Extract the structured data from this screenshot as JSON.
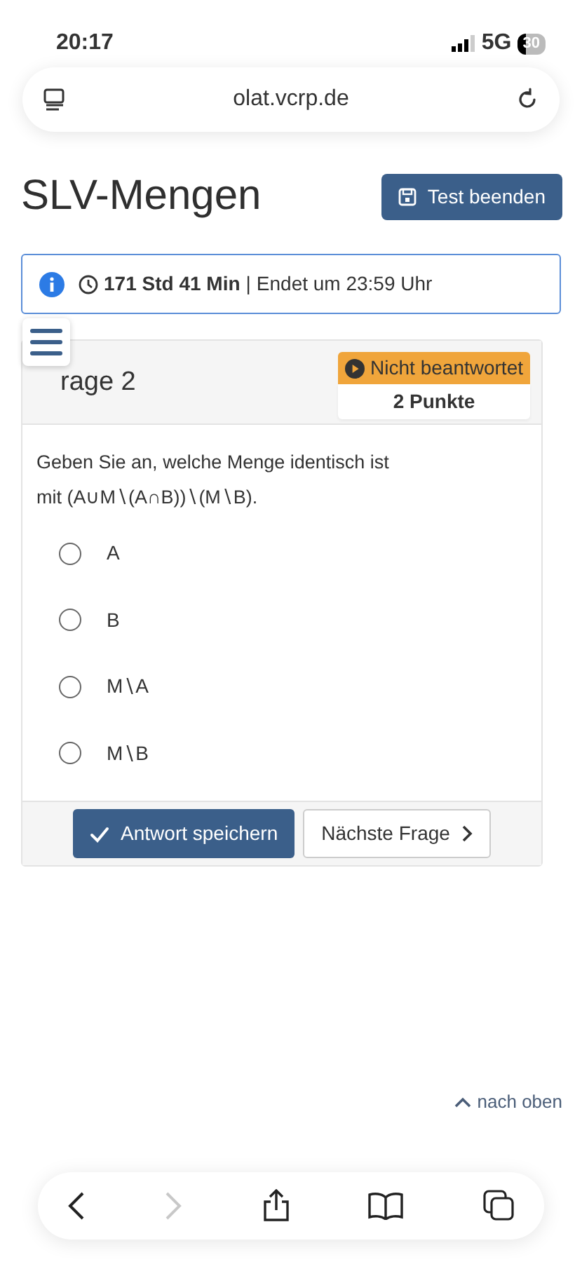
{
  "status_bar": {
    "time": "20:17",
    "network": "5G",
    "battery": "30"
  },
  "browser": {
    "url": "olat.vcrp.de"
  },
  "page": {
    "title": "SLV-Mengen",
    "end_button": "Test beenden"
  },
  "timer": {
    "remaining": "171 Std 41 Min",
    "separator": "|",
    "ends": "Endet um 23:59 Uhr"
  },
  "question": {
    "title": "rage 2",
    "status": "Nicht beantwortet",
    "points": "2 Punkte",
    "text": "Geben Sie an, welche Menge identisch ist mit (A∪M∖(A∩B))∖(M∖B).",
    "options": [
      {
        "label": "A",
        "selected": false
      },
      {
        "label": "B",
        "selected": false
      },
      {
        "label": "M∖A",
        "selected": false
      },
      {
        "label": "M∖B",
        "selected": false
      }
    ],
    "save_button": "Antwort speichern",
    "next_button": "Nächste Frage"
  },
  "back_to_top": "nach oben",
  "toolbar": {
    "forward_disabled": true
  }
}
